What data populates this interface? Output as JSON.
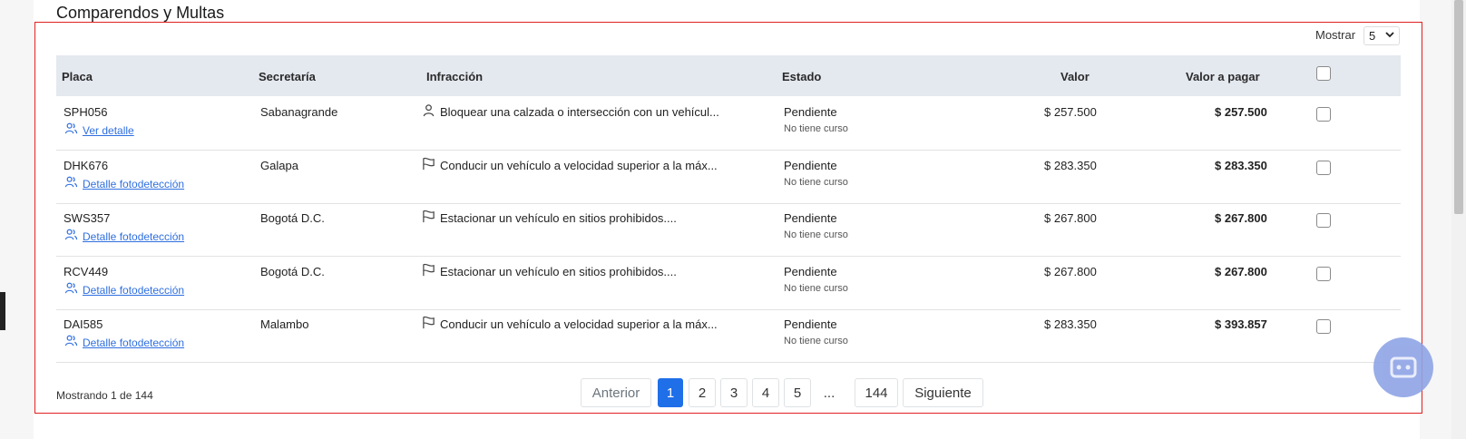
{
  "section": {
    "title": "Comparendos y Multas"
  },
  "controls": {
    "mostrar_label": "Mostrar",
    "page_size": "5"
  },
  "table": {
    "headers": {
      "placa": "Placa",
      "secretaria": "Secretaría",
      "infraccion": "Infracción",
      "estado": "Estado",
      "valor": "Valor",
      "valor_pagar": "Valor a pagar"
    },
    "rows": [
      {
        "placa": "SPH056",
        "link": "Ver detalle",
        "secretaria": "Sabanagrande",
        "infraccion_icon": "person-icon",
        "infraccion": "Bloquear una calzada o intersección con un vehícul...",
        "estado": "Pendiente",
        "curso": "No tiene curso",
        "valor": "$ 257.500",
        "valor_pagar": "$ 257.500"
      },
      {
        "placa": "DHK676",
        "link": "Detalle fotodetección",
        "secretaria": "Galapa",
        "infraccion_icon": "flag-icon",
        "infraccion": "Conducir un vehículo a velocidad superior a la máx...",
        "estado": "Pendiente",
        "curso": "No tiene curso",
        "valor": "$ 283.350",
        "valor_pagar": "$ 283.350"
      },
      {
        "placa": "SWS357",
        "link": "Detalle fotodetección",
        "secretaria": "Bogotá D.C.",
        "infraccion_icon": "flag-icon",
        "infraccion": "Estacionar un vehículo en sitios prohibidos....",
        "estado": "Pendiente",
        "curso": "No tiene curso",
        "valor": "$ 267.800",
        "valor_pagar": "$ 267.800"
      },
      {
        "placa": "RCV449",
        "link": "Detalle fotodetección",
        "secretaria": "Bogotá D.C.",
        "infraccion_icon": "flag-icon",
        "infraccion": "Estacionar un vehículo en sitios prohibidos....",
        "estado": "Pendiente",
        "curso": "No tiene curso",
        "valor": "$ 267.800",
        "valor_pagar": "$ 267.800"
      },
      {
        "placa": "DAI585",
        "link": "Detalle fotodetección",
        "secretaria": "Malambo",
        "infraccion_icon": "flag-icon",
        "infraccion": "Conducir un vehículo a velocidad superior a la máx...",
        "estado": "Pendiente",
        "curso": "No tiene curso",
        "valor": "$ 283.350",
        "valor_pagar": "$ 393.857"
      }
    ]
  },
  "footer": {
    "showing": "Mostrando 1 de 144"
  },
  "pagination": {
    "prev": "Anterior",
    "pages": [
      "1",
      "2",
      "3",
      "4",
      "5"
    ],
    "ellipsis": "...",
    "last": "144",
    "next": "Siguiente",
    "active_page": "1"
  },
  "colors": {
    "accent": "#1f6fe8",
    "link": "#2f6fe0",
    "header_bg": "#e4e8ef",
    "frame": "#e02020"
  }
}
